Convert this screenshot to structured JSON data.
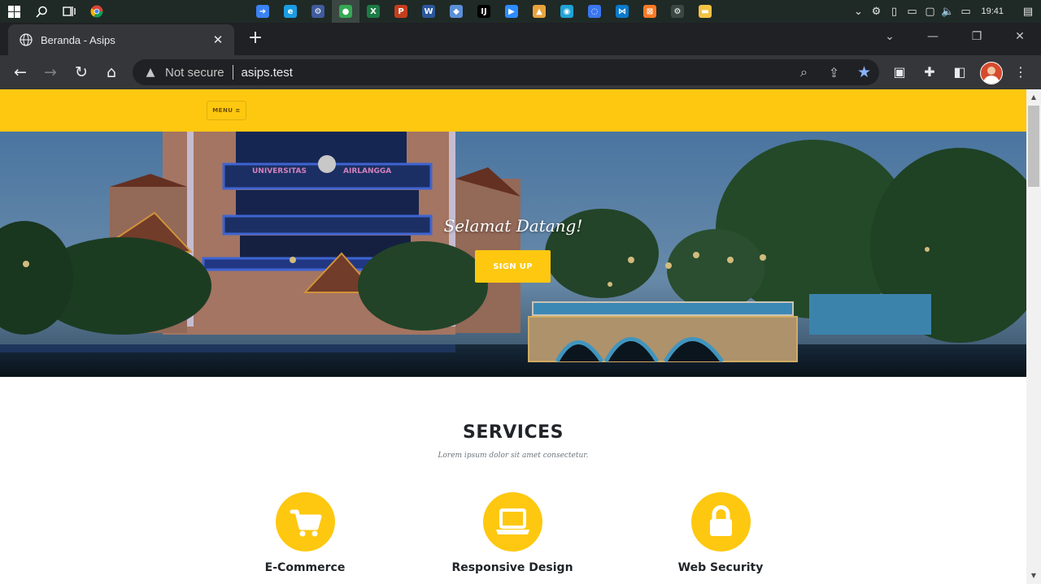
{
  "taskbar": {
    "start_icon": "windows-logo-icon",
    "clock": "19:41",
    "apps": [
      {
        "name": "arrow-app-icon",
        "color": "#3b82f6",
        "glyph": "➜"
      },
      {
        "name": "edge-icon",
        "color": "#1b9de2",
        "glyph": "e"
      },
      {
        "name": "settings-app-icon",
        "color": "#3f5b9c",
        "glyph": "⚙"
      },
      {
        "name": "chrome-icon",
        "color": "#34a853",
        "glyph": "●",
        "active": true
      },
      {
        "name": "excel-icon",
        "color": "#1d7a45",
        "glyph": "X"
      },
      {
        "name": "powerpoint-icon",
        "color": "#c43e1c",
        "glyph": "P"
      },
      {
        "name": "word-icon",
        "color": "#2b579a",
        "glyph": "W"
      },
      {
        "name": "shield-app-icon",
        "color": "#5a8fd8",
        "glyph": "◆"
      },
      {
        "name": "intellij-icon",
        "color": "#000000",
        "glyph": "IJ"
      },
      {
        "name": "zoom-icon",
        "color": "#2d8cff",
        "glyph": "▶"
      },
      {
        "name": "drive-app-icon",
        "color": "#e8a33d",
        "glyph": "▲"
      },
      {
        "name": "globe-app-icon",
        "color": "#1fa3d6",
        "glyph": "◉"
      },
      {
        "name": "signal-app-icon",
        "color": "#3a76f0",
        "glyph": "◌"
      },
      {
        "name": "vscode-icon",
        "color": "#0a7acc",
        "glyph": "⋈"
      },
      {
        "name": "xampp-icon",
        "color": "#fb7a24",
        "glyph": "⊠"
      },
      {
        "name": "gear-app-icon",
        "color": "#3a4742",
        "glyph": "⚙"
      },
      {
        "name": "folder-app-icon",
        "color": "#f3c244",
        "glyph": "▬"
      }
    ]
  },
  "browser": {
    "tab_title": "Beranda - Asips",
    "security_label": "Not secure",
    "url": "asips.test"
  },
  "site": {
    "menu_label": "MENU ≡",
    "hero_lead": "Selamat Datang!",
    "signup_label": "SIGN UP",
    "services_heading": "SERVICES",
    "services_subheading": "Lorem ipsum dolor sit amet consectetur.",
    "services": [
      {
        "title": "E-Commerce",
        "icon": "shopping-cart-icon"
      },
      {
        "title": "Responsive Design",
        "icon": "laptop-icon"
      },
      {
        "title": "Web Security",
        "icon": "lock-icon"
      }
    ]
  },
  "colors": {
    "accent": "#fec810",
    "heading": "#212529",
    "muted": "#6c757d"
  }
}
